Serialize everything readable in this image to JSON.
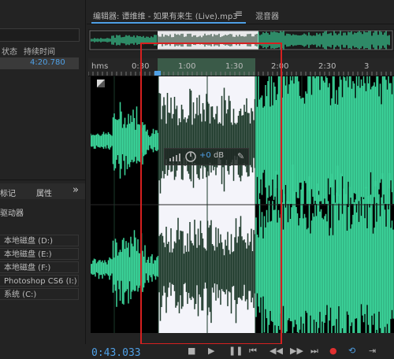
{
  "left_panel": {
    "col_status": "状态",
    "col_duration": "持续时间",
    "row_duration": "4:20.780",
    "tab_markers": "标记",
    "tab_properties": "属性",
    "more_label": "»",
    "drives_header": "驱动器",
    "drives": [
      "本地磁盘 (D:)",
      "本地磁盘 (E:)",
      "本地磁盘 (F:)",
      "Photoshop CS6 (I:)",
      "系统 (C:)"
    ]
  },
  "editor": {
    "tab_editor": "编辑器: 谭维维 - 如果有来生 (Live).mp3",
    "menu_icon": "≡",
    "tab_mixer": "混音器"
  },
  "ruler": {
    "unit": "hms",
    "ticks": [
      "0:30",
      "1:00",
      "1:30",
      "2:00",
      "2:30"
    ]
  },
  "hud": {
    "value": "+0",
    "unit": "dB"
  },
  "transport": {
    "timecode": "0:43.033",
    "icons": [
      "stop-icon",
      "play-icon",
      "pause-icon",
      "goto-start-icon",
      "rewind-icon",
      "fastforward-icon",
      "goto-end-icon",
      "record-icon",
      "loop-icon",
      "skip-icon"
    ]
  },
  "colors": {
    "waveform": "#3cd69b",
    "selection_bg": "#f4f4fa",
    "selection_wave": "#1f3b2c",
    "accent": "#4fa0e6",
    "highlight_box": "#d62020"
  }
}
